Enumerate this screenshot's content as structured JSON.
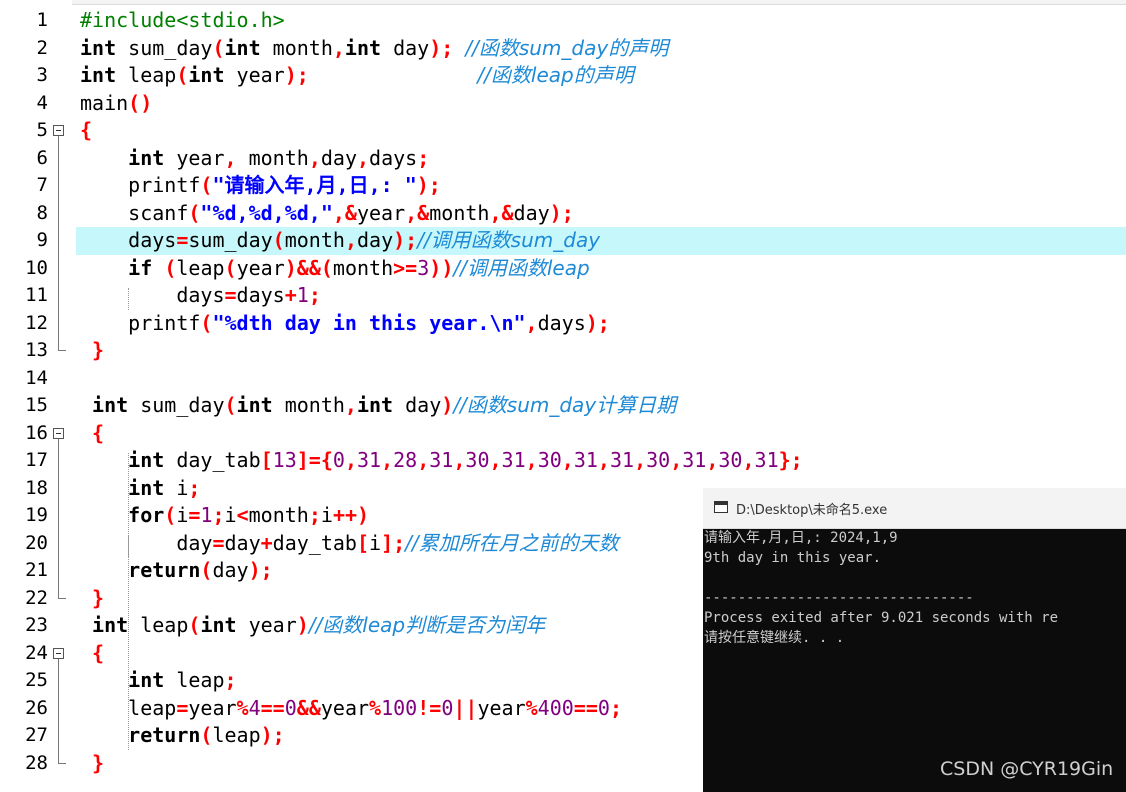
{
  "editor": {
    "line_numbers": [
      "1",
      "2",
      "3",
      "4",
      "5",
      "6",
      "7",
      "8",
      "9",
      "10",
      "11",
      "12",
      "13",
      "14",
      "15",
      "16",
      "17",
      "18",
      "19",
      "20",
      "21",
      "22",
      "23",
      "24",
      "25",
      "26",
      "27",
      "28"
    ],
    "lines": [
      [
        {
          "t": "#include<stdio.h>",
          "c": "pp"
        }
      ],
      [
        {
          "t": "int",
          "c": "kw"
        },
        {
          "t": " sum_day"
        },
        {
          "t": "(",
          "c": "op"
        },
        {
          "t": "int",
          "c": "kw"
        },
        {
          "t": " month"
        },
        {
          "t": ",",
          "c": "op"
        },
        {
          "t": "int",
          "c": "kw"
        },
        {
          "t": " day"
        },
        {
          "t": ");",
          "c": "op"
        },
        {
          "t": " "
        },
        {
          "t": "//函数sum_day的声明",
          "c": "cm"
        }
      ],
      [
        {
          "t": "int",
          "c": "kw"
        },
        {
          "t": " leap"
        },
        {
          "t": "(",
          "c": "op"
        },
        {
          "t": "int",
          "c": "kw"
        },
        {
          "t": " year"
        },
        {
          "t": ");",
          "c": "op"
        },
        {
          "t": "              "
        },
        {
          "t": "//函数leap的声明",
          "c": "cm"
        }
      ],
      [
        {
          "t": "main"
        },
        {
          "t": "()",
          "c": "op"
        }
      ],
      [
        {
          "t": "{",
          "c": "op"
        }
      ],
      [
        {
          "t": "    "
        },
        {
          "t": "int",
          "c": "kw"
        },
        {
          "t": " year"
        },
        {
          "t": ",",
          "c": "op"
        },
        {
          "t": " month"
        },
        {
          "t": ",",
          "c": "op"
        },
        {
          "t": "day"
        },
        {
          "t": ",",
          "c": "op"
        },
        {
          "t": "days"
        },
        {
          "t": ";",
          "c": "op"
        }
      ],
      [
        {
          "t": "    printf"
        },
        {
          "t": "(",
          "c": "op"
        },
        {
          "t": "\"请输入年,月,日,: \"",
          "c": "str"
        },
        {
          "t": ");",
          "c": "op"
        }
      ],
      [
        {
          "t": "    scanf"
        },
        {
          "t": "(",
          "c": "op"
        },
        {
          "t": "\"%d,%d,%d,\"",
          "c": "str"
        },
        {
          "t": ",&",
          "c": "op"
        },
        {
          "t": "year"
        },
        {
          "t": ",&",
          "c": "op"
        },
        {
          "t": "month"
        },
        {
          "t": ",&",
          "c": "op"
        },
        {
          "t": "day"
        },
        {
          "t": ");",
          "c": "op"
        }
      ],
      [
        {
          "t": "    days"
        },
        {
          "t": "=",
          "c": "op"
        },
        {
          "t": "sum_day"
        },
        {
          "t": "(",
          "c": "op"
        },
        {
          "t": "month"
        },
        {
          "t": ",",
          "c": "op"
        },
        {
          "t": "day"
        },
        {
          "t": ");",
          "c": "op"
        },
        {
          "t": "//调用函数sum_day",
          "c": "cm"
        }
      ],
      [
        {
          "t": "    "
        },
        {
          "t": "if",
          "c": "kw"
        },
        {
          "t": " "
        },
        {
          "t": "(",
          "c": "op"
        },
        {
          "t": "leap"
        },
        {
          "t": "(",
          "c": "op"
        },
        {
          "t": "year"
        },
        {
          "t": ")&&(",
          "c": "op"
        },
        {
          "t": "month"
        },
        {
          "t": ">=",
          "c": "op"
        },
        {
          "t": "3",
          "c": "num"
        },
        {
          "t": "))",
          "c": "op"
        },
        {
          "t": "//调用函数leap",
          "c": "cm"
        }
      ],
      [
        {
          "t": "        days"
        },
        {
          "t": "=",
          "c": "op"
        },
        {
          "t": "days"
        },
        {
          "t": "+",
          "c": "op"
        },
        {
          "t": "1",
          "c": "num"
        },
        {
          "t": ";",
          "c": "op"
        }
      ],
      [
        {
          "t": "    printf"
        },
        {
          "t": "(",
          "c": "op"
        },
        {
          "t": "\"%dth day in this year.\\n\"",
          "c": "str"
        },
        {
          "t": ",",
          "c": "op"
        },
        {
          "t": "days"
        },
        {
          "t": ");",
          "c": "op"
        }
      ],
      [
        {
          "t": " "
        },
        {
          "t": "}",
          "c": "op"
        }
      ],
      [],
      [
        {
          "t": " "
        },
        {
          "t": "int",
          "c": "kw"
        },
        {
          "t": " sum_day"
        },
        {
          "t": "(",
          "c": "op"
        },
        {
          "t": "int",
          "c": "kw"
        },
        {
          "t": " month"
        },
        {
          "t": ",",
          "c": "op"
        },
        {
          "t": "int",
          "c": "kw"
        },
        {
          "t": " day"
        },
        {
          "t": ")",
          "c": "op"
        },
        {
          "t": "//函数sum_day计算日期",
          "c": "cm"
        }
      ],
      [
        {
          "t": " "
        },
        {
          "t": "{",
          "c": "op"
        }
      ],
      [
        {
          "t": "    "
        },
        {
          "t": "int",
          "c": "kw"
        },
        {
          "t": " day_tab"
        },
        {
          "t": "[",
          "c": "op"
        },
        {
          "t": "13",
          "c": "num"
        },
        {
          "t": "]={",
          "c": "op"
        },
        {
          "t": "0",
          "c": "num"
        },
        {
          "t": ",",
          "c": "op"
        },
        {
          "t": "31",
          "c": "num"
        },
        {
          "t": ",",
          "c": "op"
        },
        {
          "t": "28",
          "c": "num"
        },
        {
          "t": ",",
          "c": "op"
        },
        {
          "t": "31",
          "c": "num"
        },
        {
          "t": ",",
          "c": "op"
        },
        {
          "t": "30",
          "c": "num"
        },
        {
          "t": ",",
          "c": "op"
        },
        {
          "t": "31",
          "c": "num"
        },
        {
          "t": ",",
          "c": "op"
        },
        {
          "t": "30",
          "c": "num"
        },
        {
          "t": ",",
          "c": "op"
        },
        {
          "t": "31",
          "c": "num"
        },
        {
          "t": ",",
          "c": "op"
        },
        {
          "t": "31",
          "c": "num"
        },
        {
          "t": ",",
          "c": "op"
        },
        {
          "t": "30",
          "c": "num"
        },
        {
          "t": ",",
          "c": "op"
        },
        {
          "t": "31",
          "c": "num"
        },
        {
          "t": ",",
          "c": "op"
        },
        {
          "t": "30",
          "c": "num"
        },
        {
          "t": ",",
          "c": "op"
        },
        {
          "t": "31",
          "c": "num"
        },
        {
          "t": "};",
          "c": "op"
        }
      ],
      [
        {
          "t": "    "
        },
        {
          "t": "int",
          "c": "kw"
        },
        {
          "t": " i"
        },
        {
          "t": ";",
          "c": "op"
        }
      ],
      [
        {
          "t": "    "
        },
        {
          "t": "for",
          "c": "kw"
        },
        {
          "t": "(",
          "c": "op"
        },
        {
          "t": "i"
        },
        {
          "t": "=",
          "c": "op"
        },
        {
          "t": "1",
          "c": "num"
        },
        {
          "t": ";",
          "c": "op"
        },
        {
          "t": "i"
        },
        {
          "t": "<",
          "c": "op"
        },
        {
          "t": "month"
        },
        {
          "t": ";",
          "c": "op"
        },
        {
          "t": "i"
        },
        {
          "t": "++)",
          "c": "op"
        }
      ],
      [
        {
          "t": "        day"
        },
        {
          "t": "=",
          "c": "op"
        },
        {
          "t": "day"
        },
        {
          "t": "+",
          "c": "op"
        },
        {
          "t": "day_tab"
        },
        {
          "t": "[",
          "c": "op"
        },
        {
          "t": "i"
        },
        {
          "t": "];",
          "c": "op"
        },
        {
          "t": "//累加所在月之前的天数",
          "c": "cm"
        }
      ],
      [
        {
          "t": "    "
        },
        {
          "t": "return",
          "c": "kw"
        },
        {
          "t": "(",
          "c": "op"
        },
        {
          "t": "day"
        },
        {
          "t": ");",
          "c": "op"
        }
      ],
      [
        {
          "t": " "
        },
        {
          "t": "}",
          "c": "op"
        }
      ],
      [
        {
          "t": " "
        },
        {
          "t": "int",
          "c": "kw"
        },
        {
          "t": " leap"
        },
        {
          "t": "(",
          "c": "op"
        },
        {
          "t": "int",
          "c": "kw"
        },
        {
          "t": " year"
        },
        {
          "t": ")",
          "c": "op"
        },
        {
          "t": "//函数leap判断是否为闰年",
          "c": "cm"
        }
      ],
      [
        {
          "t": " "
        },
        {
          "t": "{",
          "c": "op"
        }
      ],
      [
        {
          "t": "    "
        },
        {
          "t": "int",
          "c": "kw"
        },
        {
          "t": " leap"
        },
        {
          "t": ";",
          "c": "op"
        }
      ],
      [
        {
          "t": "    leap"
        },
        {
          "t": "=",
          "c": "op"
        },
        {
          "t": "year"
        },
        {
          "t": "%",
          "c": "op"
        },
        {
          "t": "4",
          "c": "num"
        },
        {
          "t": "==",
          "c": "op"
        },
        {
          "t": "0",
          "c": "num"
        },
        {
          "t": "&&",
          "c": "op"
        },
        {
          "t": "year"
        },
        {
          "t": "%",
          "c": "op"
        },
        {
          "t": "100",
          "c": "num"
        },
        {
          "t": "!=",
          "c": "op"
        },
        {
          "t": "0",
          "c": "num"
        },
        {
          "t": "||",
          "c": "op"
        },
        {
          "t": "year"
        },
        {
          "t": "%",
          "c": "op"
        },
        {
          "t": "400",
          "c": "num"
        },
        {
          "t": "==",
          "c": "op"
        },
        {
          "t": "0",
          "c": "num"
        },
        {
          "t": ";",
          "c": "op"
        }
      ],
      [
        {
          "t": "    "
        },
        {
          "t": "return",
          "c": "kw"
        },
        {
          "t": "(",
          "c": "op"
        },
        {
          "t": "leap"
        },
        {
          "t": ");",
          "c": "op"
        }
      ],
      [
        {
          "t": " "
        },
        {
          "t": "}",
          "c": "op"
        }
      ]
    ],
    "highlighted_line": 9,
    "colors": {
      "keyword": "#000000",
      "operator": "#ff0000",
      "string": "#0000ff",
      "number": "#800080",
      "preprocessor": "#008000",
      "comment": "#1e8ad6",
      "current_line": "#c6f7fb"
    }
  },
  "console": {
    "title": "D:\\Desktop\\未命名5.exe",
    "icon": "console-window-icon",
    "lines": [
      "请输入年,月,日,: 2024,1,9",
      "9th day in this year.",
      "",
      "--------------------------------",
      "Process exited after 9.021 seconds with re",
      "请按任意键继续. . ."
    ]
  },
  "watermark": "CSDN @CYR19Gin"
}
